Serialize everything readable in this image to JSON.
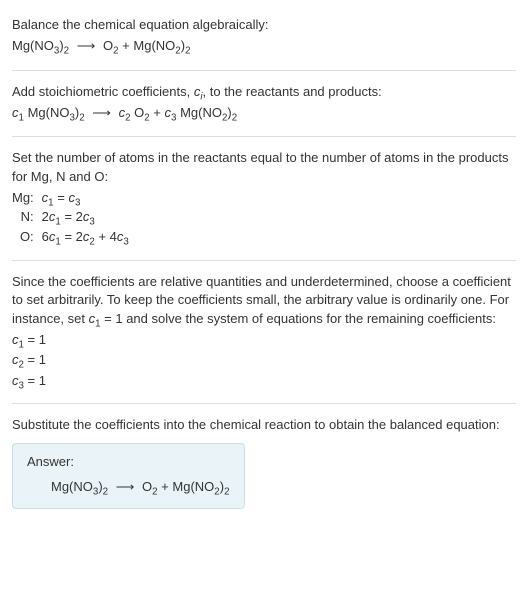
{
  "section1": {
    "instruction": "Balance the chemical equation algebraically:"
  },
  "section2": {
    "instruction": "Add stoichiometric coefficients, ",
    "ci": "c",
    "ci_sub": "i",
    "instruction_end": ", to the reactants and products:"
  },
  "section3": {
    "instruction": "Set the number of atoms in the reactants equal to the number of atoms in the products for Mg, N and O:",
    "atoms": {
      "mg_label": "Mg:",
      "n_label": "N:",
      "o_label": "O:"
    }
  },
  "section4": {
    "instruction_p1": "Since the coefficients are relative quantities and underdetermined, choose a coefficient to set arbitrarily. To keep the coefficients small, the arbitrary value is ordinarily one. For instance, set ",
    "instruction_p2": " = 1 and solve the system of equations for the remaining coefficients:"
  },
  "section5": {
    "instruction": "Substitute the coefficients into the chemical reaction to obtain the balanced equation:"
  },
  "answer": {
    "label": "Answer:"
  },
  "chem": {
    "mgno3": {
      "base": "Mg(NO",
      "s1": "3",
      "mid": ")",
      "s2": "2"
    },
    "o2": {
      "base": "O",
      "s1": "2"
    },
    "mgno2": {
      "base": "Mg(NO",
      "s1": "2",
      "mid": ")",
      "s2": "2"
    },
    "arrow": "⟶",
    "plus": " + "
  },
  "coeff": {
    "c": "c",
    "s1": "1",
    "s2": "2",
    "s3": "3",
    "eq": " = ",
    "two": "2",
    "six": "6",
    "four": "4",
    "one": "1",
    "plus": " + "
  }
}
